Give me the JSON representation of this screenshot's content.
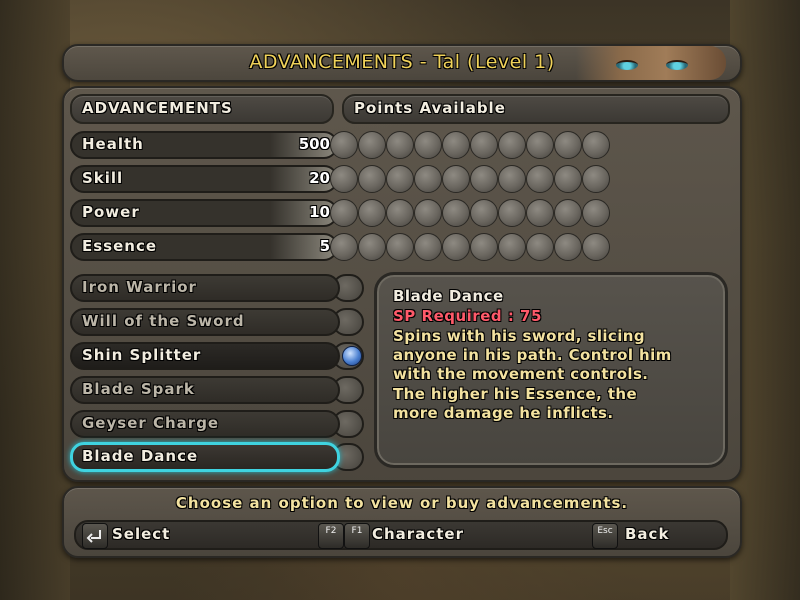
{
  "title": "ADVANCEMENTS - Tal (Level 1)",
  "header": {
    "section_label": "ADVANCEMENTS",
    "points_label": "Points Available"
  },
  "stats": [
    {
      "name": "Health",
      "value": "500"
    },
    {
      "name": "Skill",
      "value": "20"
    },
    {
      "name": "Power",
      "value": "10"
    },
    {
      "name": "Essence",
      "value": "5"
    }
  ],
  "stat_slots_per_row": 10,
  "skills": [
    {
      "name": "Iron Warrior",
      "state": "locked"
    },
    {
      "name": "Will of the Sword",
      "state": "locked"
    },
    {
      "name": "Shin Splitter",
      "state": "learned"
    },
    {
      "name": "Blade Spark",
      "state": "locked"
    },
    {
      "name": "Geyser Charge",
      "state": "locked"
    },
    {
      "name": "Blade Dance",
      "state": "selected"
    }
  ],
  "detail": {
    "title": "Blade Dance",
    "sp_required": "SP Required : 75",
    "lines": [
      "Spins with his sword, slicing",
      "anyone in his path. Control him",
      "with the movement controls.",
      "The higher his Essence, the",
      "more damage he inflicts."
    ]
  },
  "footer": {
    "hint": "Choose an option to view or buy advancements.",
    "actions": [
      {
        "keys": [
          "enter-icon"
        ],
        "label": "Select"
      },
      {
        "keys": [
          "F2",
          "F1"
        ],
        "label": "Character"
      },
      {
        "keys": [
          "Esc"
        ],
        "label": "Back"
      }
    ]
  },
  "colors": {
    "title": "#f0d25a",
    "selection_outline": "#3fd3e0",
    "sp_required": "#ff5a6a",
    "description_text": "#f3e2a0"
  }
}
